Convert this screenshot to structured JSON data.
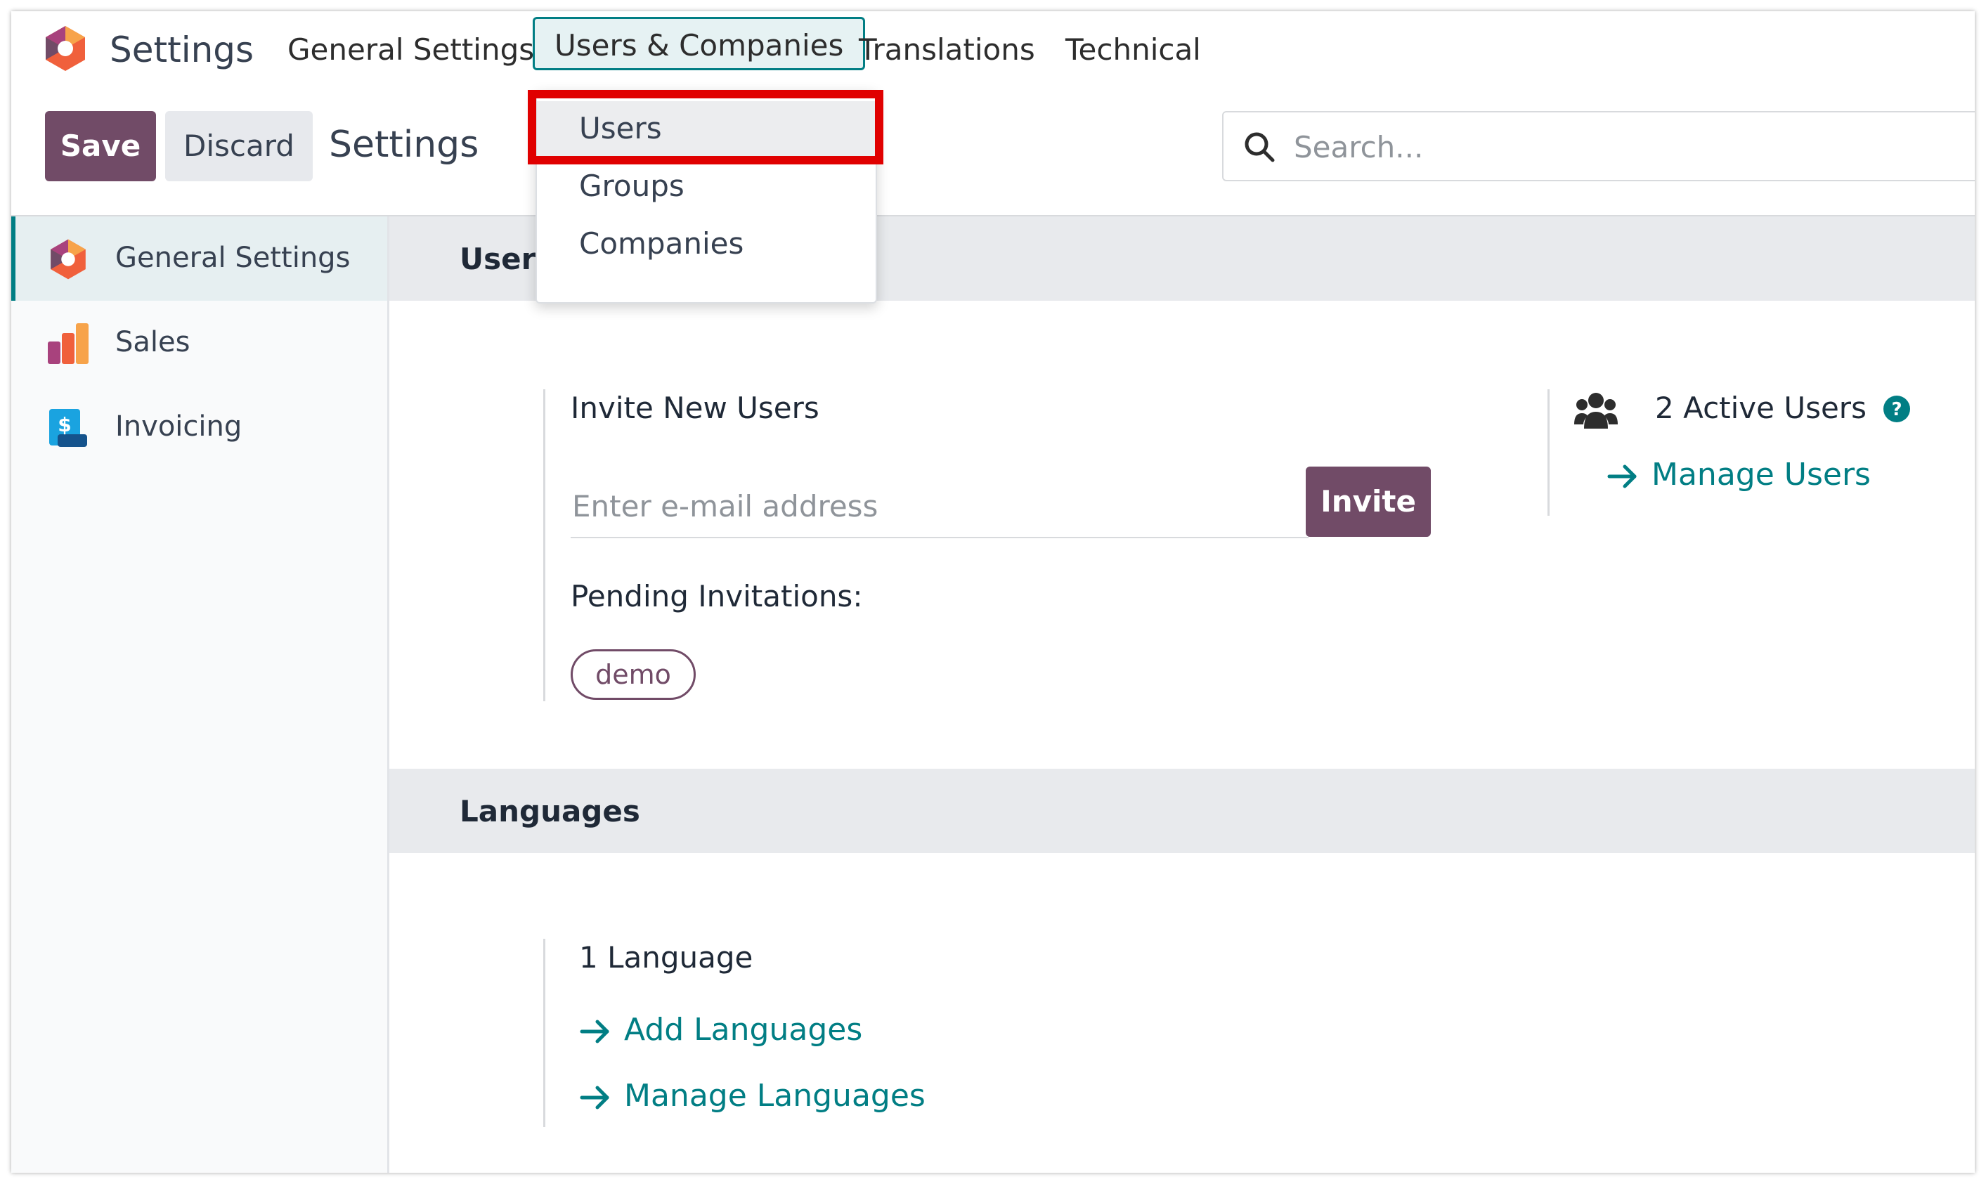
{
  "navbar": {
    "app_name": "Settings",
    "menu": [
      {
        "label": "General Settings"
      },
      {
        "label": "Users & Companies"
      },
      {
        "label": "Translations"
      },
      {
        "label": "Technical"
      }
    ]
  },
  "dropdown": {
    "items": [
      {
        "label": "Users"
      },
      {
        "label": "Groups"
      },
      {
        "label": "Companies"
      }
    ]
  },
  "control_panel": {
    "save_label": "Save",
    "discard_label": "Discard",
    "breadcrumb": "Settings",
    "search_placeholder": "Search..."
  },
  "sidebar": {
    "items": [
      {
        "label": "General Settings",
        "icon": "settings-app-icon"
      },
      {
        "label": "Sales",
        "icon": "sales-app-icon"
      },
      {
        "label": "Invoicing",
        "icon": "invoicing-app-icon"
      }
    ]
  },
  "users_section": {
    "title": "Users",
    "invite_heading": "Invite New Users",
    "email_placeholder": "Enter e-mail address",
    "invite_label": "Invite",
    "pending_label": "Pending Invitations:",
    "pending_tags": [
      "demo"
    ],
    "active_users": "2 Active Users",
    "manage_users": "Manage Users"
  },
  "languages_section": {
    "title": "Languages",
    "count": "1 Language",
    "add_languages": "Add Languages",
    "manage_languages": "Manage Languages"
  },
  "colors": {
    "primary": "#714b67",
    "accent": "#017e84",
    "highlight": "#e00000"
  }
}
